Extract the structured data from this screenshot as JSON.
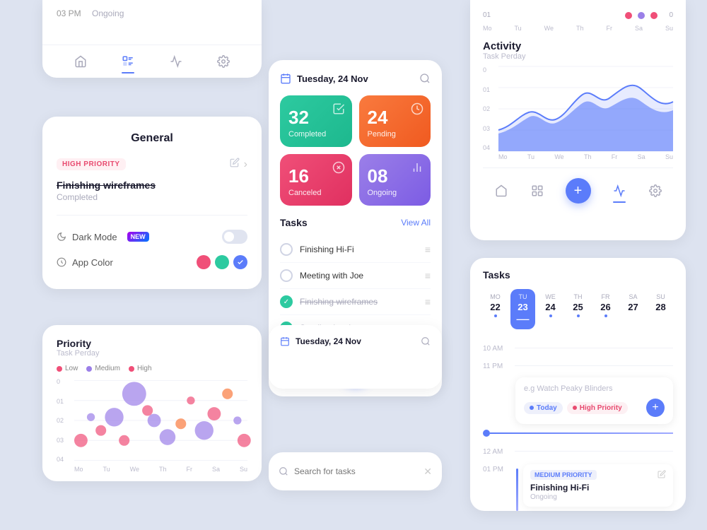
{
  "colors": {
    "primary": "#5b7cfa",
    "green": "#2dcaa0",
    "orange": "#f97a3e",
    "red": "#f04f78",
    "purple": "#9b7fe8",
    "bg": "#dde3f0"
  },
  "topleft_card": {
    "time": "03 PM",
    "status": "Ongoing",
    "nav_icons": [
      "home",
      "list",
      "chart",
      "gear"
    ]
  },
  "general_card": {
    "title": "General",
    "priority_label": "HIGH PRIORITY",
    "task_title": "Finishing wireframes",
    "task_status": "Completed",
    "settings": [
      {
        "label": "Dark Mode",
        "badge": "NEW",
        "value": false
      },
      {
        "label": "App Color"
      }
    ],
    "colors": [
      "#f04f78",
      "#2dcaa0",
      "#5b7cfa"
    ]
  },
  "main_card": {
    "date": "Tuesday, 24 Nov",
    "stats": [
      {
        "number": "32",
        "label": "Completed",
        "type": "green"
      },
      {
        "number": "24",
        "label": "Pending",
        "type": "orange"
      },
      {
        "number": "16",
        "label": "Canceled",
        "type": "red"
      },
      {
        "number": "08",
        "label": "Ongoing",
        "type": "purple"
      }
    ],
    "tasks_title": "Tasks",
    "view_all": "View All",
    "tasks": [
      {
        "name": "Finishing Hi-Fi",
        "done": false,
        "strikethrough": false
      },
      {
        "name": "Meeting with Joe",
        "done": false,
        "strikethrough": false
      },
      {
        "name": "Finishing wireframes",
        "done": true,
        "strikethrough": true
      },
      {
        "name": "Sending invoice",
        "done": true,
        "strikethrough": true
      }
    ]
  },
  "priority_card": {
    "title": "Priority",
    "subtitle": "Task Perday",
    "legend": [
      {
        "label": "Low",
        "color": "#f04f78"
      },
      {
        "label": "Medium",
        "color": "#9b7fe8"
      },
      {
        "label": "High",
        "color": "#f04f78"
      }
    ],
    "y_labels": [
      "04",
      "03",
      "02",
      "01",
      "0"
    ],
    "x_labels": [
      "Mo",
      "Tu",
      "We",
      "Th",
      "Fr",
      "Sa",
      "Su"
    ]
  },
  "activity_card": {
    "title": "Activity",
    "subtitle": "Task Perday",
    "mini_dots": [
      {
        "color": "#f04f78",
        "day": "01"
      },
      {
        "color": "#9b7fe8"
      },
      {
        "color": "#f04f78"
      }
    ],
    "y_labels": [
      "04",
      "03",
      "02",
      "01",
      "0"
    ],
    "x_labels": [
      "Mo",
      "Tu",
      "We",
      "Th",
      "Fr",
      "Sa",
      "Su"
    ]
  },
  "tasks_cal_card": {
    "title": "Tasks",
    "week": [
      {
        "label": "MO",
        "num": "22",
        "active": false,
        "dot": true
      },
      {
        "label": "TU",
        "num": "23",
        "active": true,
        "dot": true
      },
      {
        "label": "WE",
        "num": "24",
        "active": false,
        "dot": true
      },
      {
        "label": "TH",
        "num": "25",
        "active": false,
        "dot": true
      },
      {
        "label": "FR",
        "num": "26",
        "active": false,
        "dot": true
      },
      {
        "label": "SA",
        "num": "27",
        "active": false,
        "dot": false
      },
      {
        "label": "SU",
        "num": "28",
        "active": false,
        "dot": false
      }
    ],
    "time_slots": [
      {
        "time": "10 AM",
        "content": null
      },
      {
        "time": "11 PM",
        "content": null
      },
      {
        "time": "12 AM",
        "content": null
      },
      {
        "time": "01 PM",
        "event": {
          "priority": "MEDIUM PRIORITY",
          "title": "Finishing Hi-Fi",
          "status": "Ongoing"
        }
      }
    ],
    "task_popup": {
      "placeholder": "e.g Watch Peaky Blinders",
      "tags": [
        "Today",
        "High Priority"
      ]
    }
  },
  "search_card": {
    "placeholder": "Search for tasks"
  }
}
